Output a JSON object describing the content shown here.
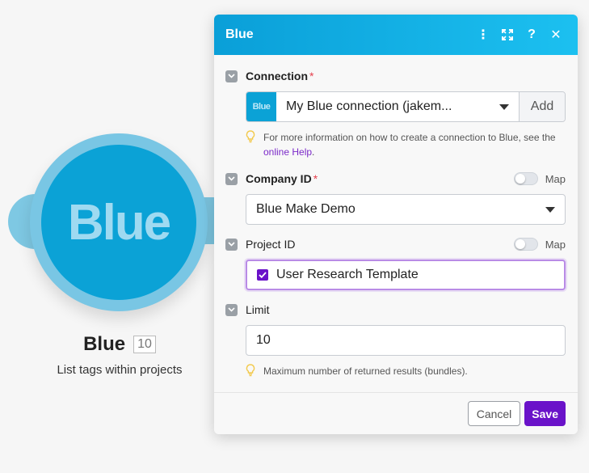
{
  "module": {
    "logo_text": "Blue",
    "title": "Blue",
    "badge": "10",
    "subtitle": "List tags within projects",
    "color": "#0ba2d6",
    "ring_color": "#79c6e4"
  },
  "dialog": {
    "title": "Blue",
    "header_icons": [
      "kebab-menu-icon",
      "expand-icon",
      "help-icon",
      "close-icon"
    ],
    "header_glyphs": {
      "menu": "⋮",
      "help": "?",
      "close": "✕"
    }
  },
  "fields": {
    "connection": {
      "label": "Connection",
      "required_mark": "*",
      "logo_text": "Blue",
      "value": "My Blue connection (jakem...",
      "add_label": "Add",
      "hint_before": "For more information on how to create a connection to Blue, see the ",
      "hint_link": "online Help",
      "hint_after": "."
    },
    "company_id": {
      "label": "Company ID",
      "required_mark": "*",
      "map_label": "Map",
      "value": "Blue Make Demo"
    },
    "project_id": {
      "label": "Project ID",
      "map_label": "Map",
      "selected_item": "User Research Template"
    },
    "limit": {
      "label": "Limit",
      "value": "10",
      "hint": "Maximum number of returned results (bundles)."
    }
  },
  "footer": {
    "cancel_label": "Cancel",
    "save_label": "Save"
  },
  "colors": {
    "accent": "#6a12c9",
    "header_start": "#0a9fd8",
    "header_end": "#1cc0f0",
    "required": "#e5404d"
  }
}
